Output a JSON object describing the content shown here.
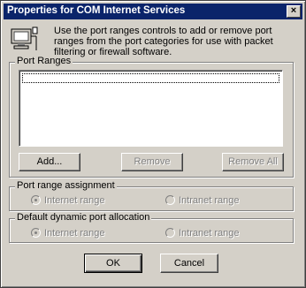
{
  "window": {
    "title": "Properties for COM Internet Services",
    "close_glyph": "×"
  },
  "description": "Use the port ranges controls to add or remove port ranges from the port categories for use with packet filtering or firewall software.",
  "port_ranges": {
    "label": "Port Ranges",
    "items": [
      ""
    ],
    "buttons": {
      "add": "Add...",
      "remove": "Remove",
      "remove_all": "Remove All"
    }
  },
  "port_range_assignment": {
    "label": "Port range assignment",
    "options": [
      {
        "label": "Internet range",
        "selected": true,
        "enabled": false
      },
      {
        "label": "Intranet range",
        "selected": false,
        "enabled": false
      }
    ]
  },
  "default_dynamic_port_allocation": {
    "label": "Default dynamic port allocation",
    "options": [
      {
        "label": "Internet range",
        "selected": true,
        "enabled": false
      },
      {
        "label": "Intranet range",
        "selected": false,
        "enabled": false
      }
    ]
  },
  "dialog_buttons": {
    "ok": "OK",
    "cancel": "Cancel"
  },
  "colors": {
    "titlebar": "#0a246a",
    "face": "#d4d0c8",
    "disabled_text": "#808080"
  },
  "icons": {
    "app": "network-computer-icon",
    "close": "close-icon"
  }
}
